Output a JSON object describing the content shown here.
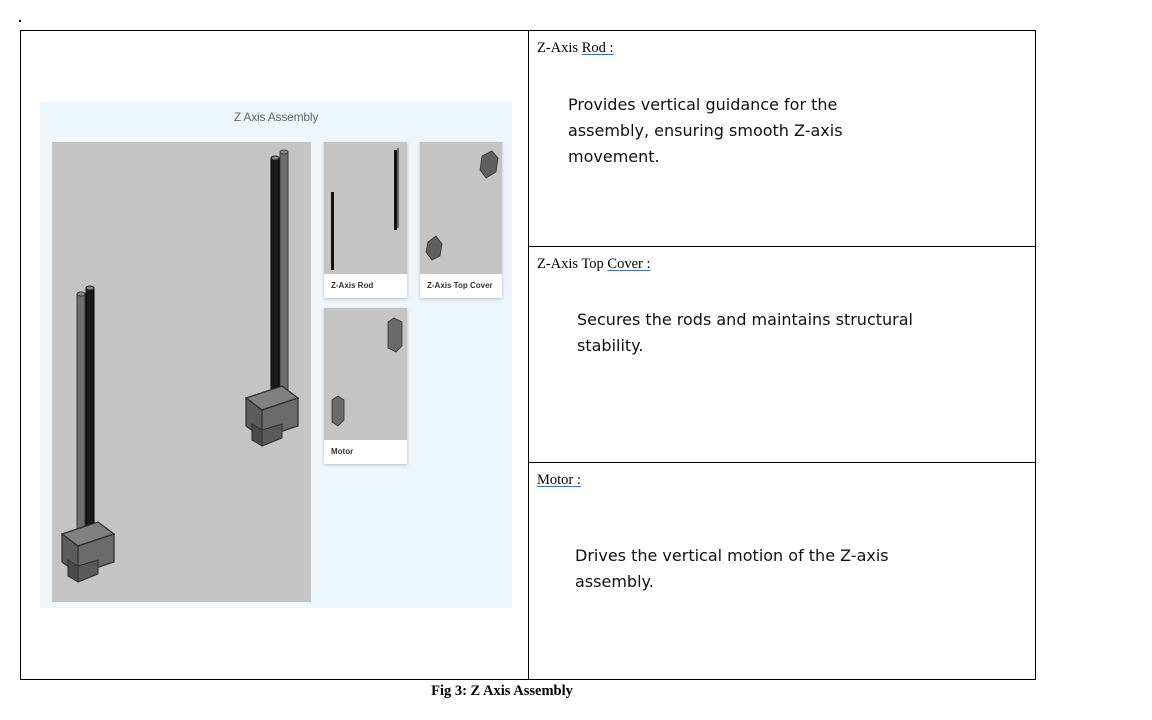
{
  "figure": {
    "title": "Z Axis Assembly",
    "cards": [
      {
        "label": "Z-Axis Rod"
      },
      {
        "label": "Z-Axis Top Cover"
      },
      {
        "label": "Motor"
      }
    ]
  },
  "rows": [
    {
      "heading_prefix": "Z-Axis ",
      "heading_underlined": "Rod :",
      "description": "Provides vertical guidance for the assembly, ensuring smooth Z-axis movement."
    },
    {
      "heading_prefix": "Z-Axis Top ",
      "heading_underlined": "Cover :",
      "description": "Secures the rods and maintains structural stability."
    },
    {
      "heading_prefix": "",
      "heading_underlined": "Motor :",
      "description": "Drives the vertical motion of the Z-axis assembly."
    }
  ],
  "caption": "Fig 3: Z Axis Assembly",
  "colors": {
    "viewport_bg": "#c4c4c4",
    "figure_bg": "#eef6fd",
    "part_dark": "#555555",
    "underline": "#3b6fd6"
  }
}
